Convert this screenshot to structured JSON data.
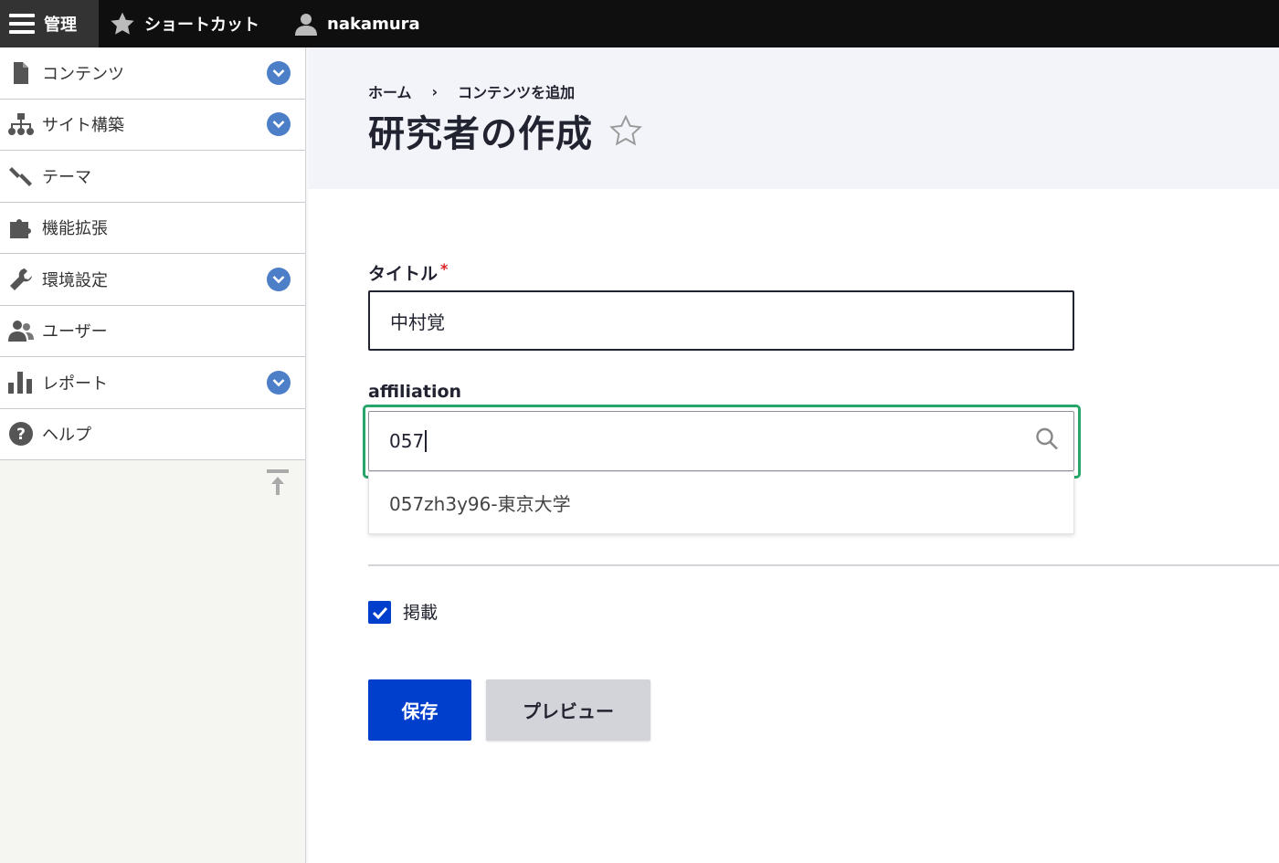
{
  "toolbar": {
    "manage_label": "管理",
    "shortcut_label": "ショートカット",
    "user_label": "nakamura"
  },
  "sidebar": {
    "items": [
      {
        "label": "コンテンツ",
        "icon": "file-icon",
        "expandable": true
      },
      {
        "label": "サイト構築",
        "icon": "sitemap-icon",
        "expandable": true
      },
      {
        "label": "テーマ",
        "icon": "paintbrush-icon",
        "expandable": false
      },
      {
        "label": "機能拡張",
        "icon": "puzzle-icon",
        "expandable": false
      },
      {
        "label": "環境設定",
        "icon": "wrench-icon",
        "expandable": true
      },
      {
        "label": "ユーザー",
        "icon": "people-icon",
        "expandable": false
      },
      {
        "label": "レポート",
        "icon": "bar-chart-icon",
        "expandable": true
      },
      {
        "label": "ヘルプ",
        "icon": "help-icon",
        "expandable": false
      }
    ]
  },
  "breadcrumb": {
    "home": "ホーム",
    "separator": "›",
    "current": "コンテンツを追加"
  },
  "page": {
    "title": "研究者の作成"
  },
  "form": {
    "title_label": "タイトル",
    "title_required": "*",
    "title_value": "中村覚",
    "affiliation_label": "affiliation",
    "affiliation_value": "057",
    "suggestion": "057zh3y96-東京大学",
    "publish_label": "掲載",
    "publish_checked": true,
    "save_label": "保存",
    "preview_label": "プレビュー"
  },
  "colors": {
    "primary": "#003ecc",
    "focus": "#26a769",
    "toggle": "#4d7ec8",
    "required": "#dc2323"
  }
}
